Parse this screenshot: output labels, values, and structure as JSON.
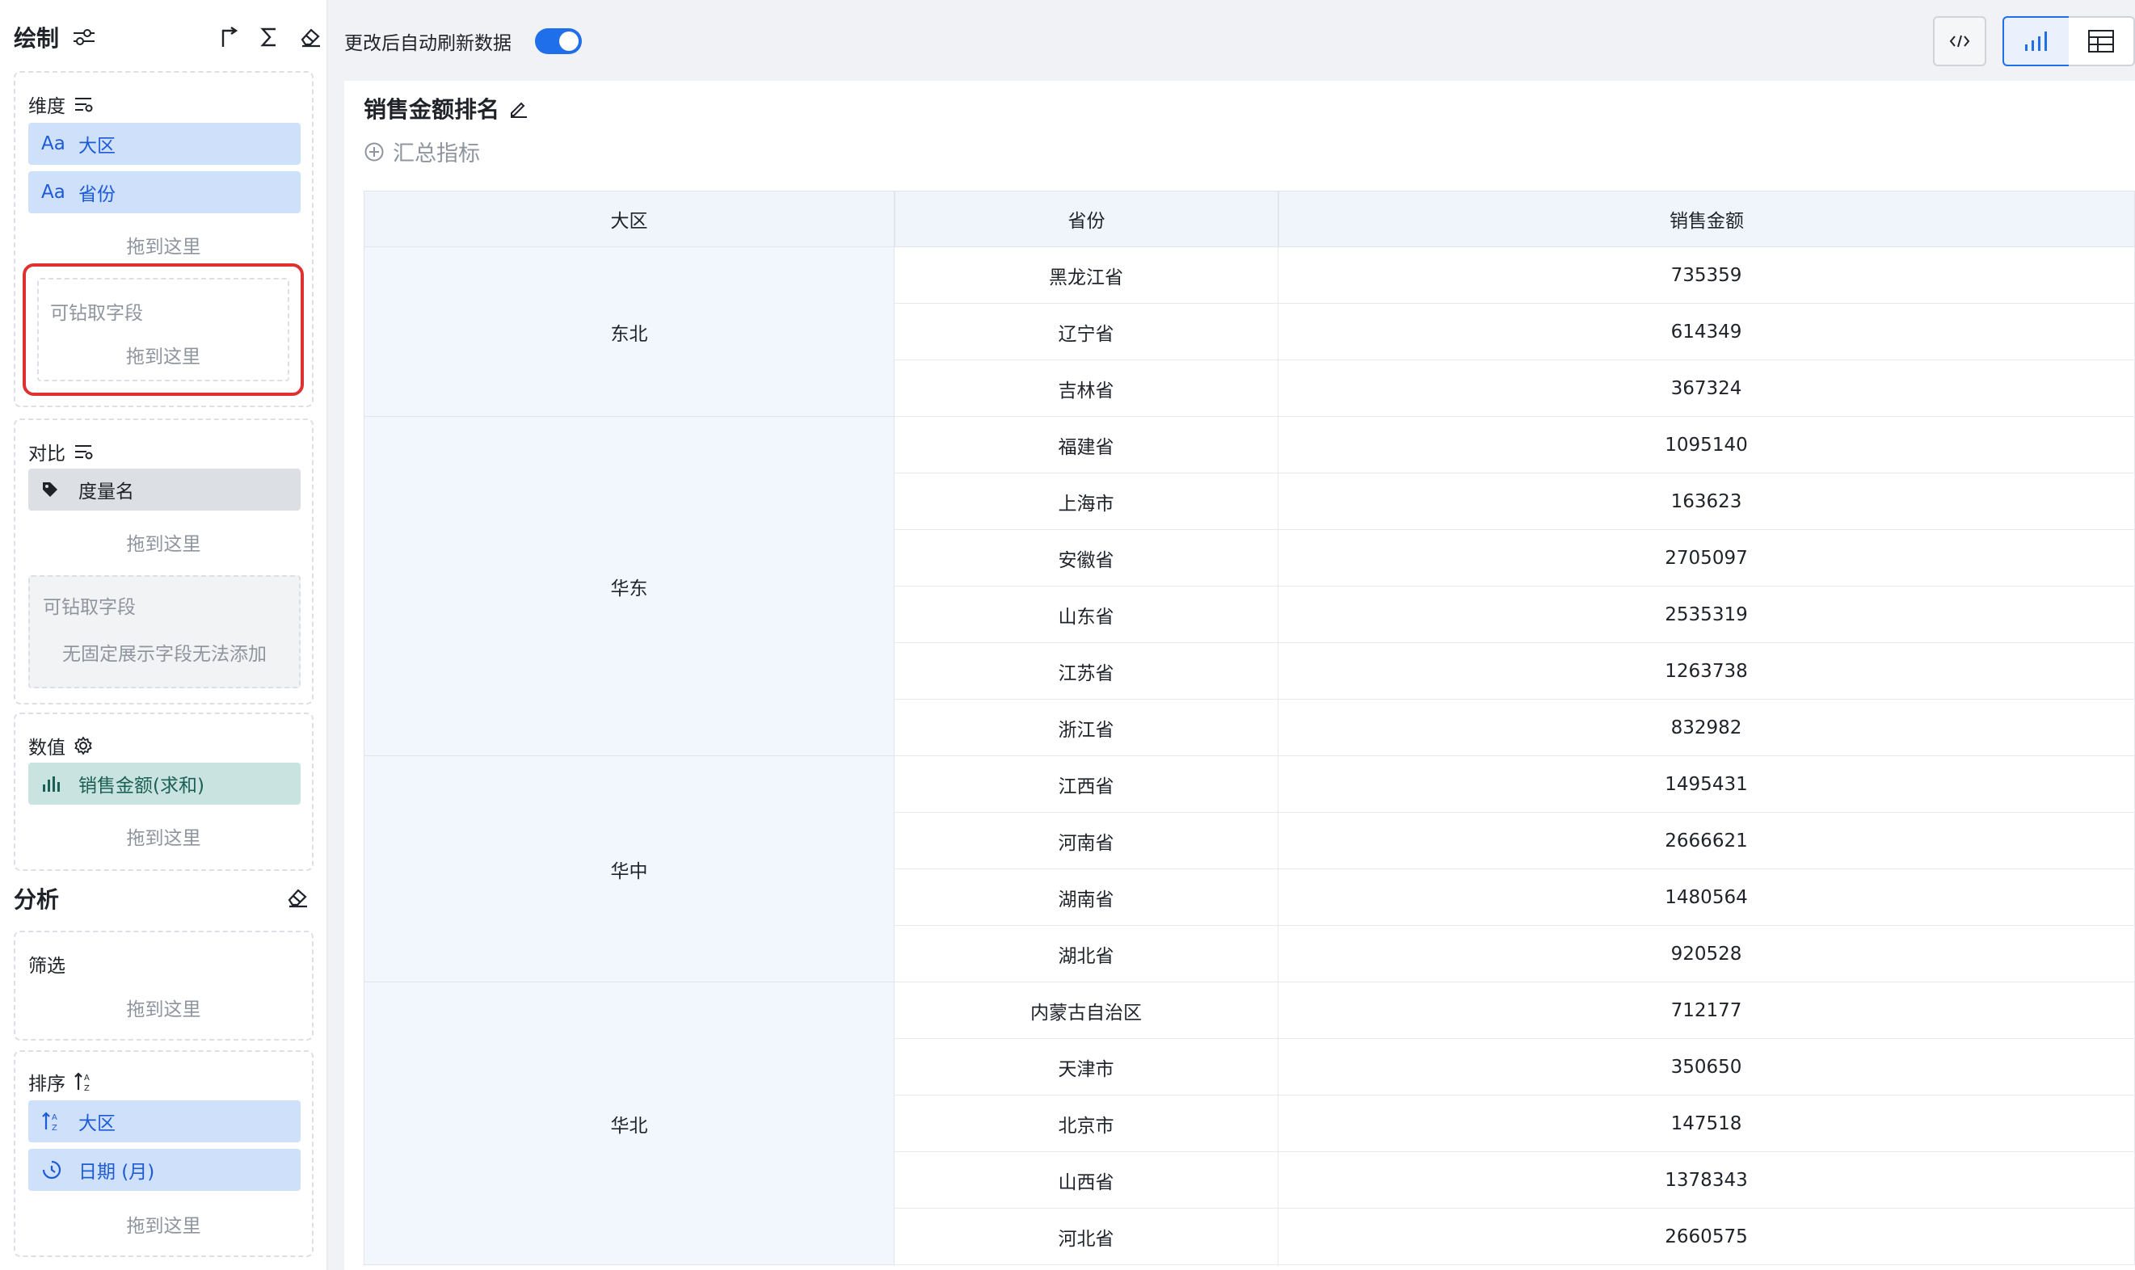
{
  "left_panel": {
    "draw_title": "绘制",
    "dimension": {
      "label": "维度",
      "fields": [
        {
          "type_label": "Aa",
          "name": "大区"
        },
        {
          "type_label": "Aa",
          "name": "省份"
        }
      ],
      "drop_hint": "拖到这里",
      "drill": {
        "label": "可钻取字段",
        "drop_hint": "拖到这里"
      }
    },
    "compare": {
      "label": "对比",
      "field": "度量名",
      "drop_hint": "拖到这里",
      "drill": {
        "label": "可钻取字段",
        "note": "无固定展示字段无法添加"
      }
    },
    "values": {
      "label": "数值",
      "field": "销售金额(求和)",
      "drop_hint": "拖到这里"
    },
    "analysis_title": "分析",
    "filter": {
      "label": "筛选",
      "drop_hint": "拖到这里"
    },
    "sort": {
      "label": "排序",
      "fields": [
        "大区",
        "日期 (月)"
      ],
      "drop_hint": "拖到这里"
    }
  },
  "toolbar": {
    "auto_refresh_label": "更改后自动刷新数据",
    "auto_refresh_on": true
  },
  "chart": {
    "title": "销售金额排名",
    "summary_label": "汇总指标"
  },
  "table": {
    "columns": [
      "大区",
      "省份",
      "销售金额"
    ],
    "groups": [
      {
        "region": "东北",
        "rows": [
          [
            "黑龙江省",
            "735359"
          ],
          [
            "辽宁省",
            "614349"
          ],
          [
            "吉林省",
            "367324"
          ]
        ]
      },
      {
        "region": "华东",
        "rows": [
          [
            "福建省",
            "1095140"
          ],
          [
            "上海市",
            "163623"
          ],
          [
            "安徽省",
            "2705097"
          ],
          [
            "山东省",
            "2535319"
          ],
          [
            "江苏省",
            "1263738"
          ],
          [
            "浙江省",
            "832982"
          ]
        ]
      },
      {
        "region": "华中",
        "rows": [
          [
            "江西省",
            "1495431"
          ],
          [
            "河南省",
            "2666621"
          ],
          [
            "湖南省",
            "1480564"
          ],
          [
            "湖北省",
            "920528"
          ]
        ]
      },
      {
        "region": "华北",
        "rows": [
          [
            "内蒙古自治区",
            "712177"
          ],
          [
            "天津市",
            "350650"
          ],
          [
            "北京市",
            "147518"
          ],
          [
            "山西省",
            "1378343"
          ],
          [
            "河北省",
            "2660575"
          ]
        ]
      }
    ]
  },
  "icons": {
    "accent": "#1f6feb",
    "highlight": "#e03131"
  }
}
